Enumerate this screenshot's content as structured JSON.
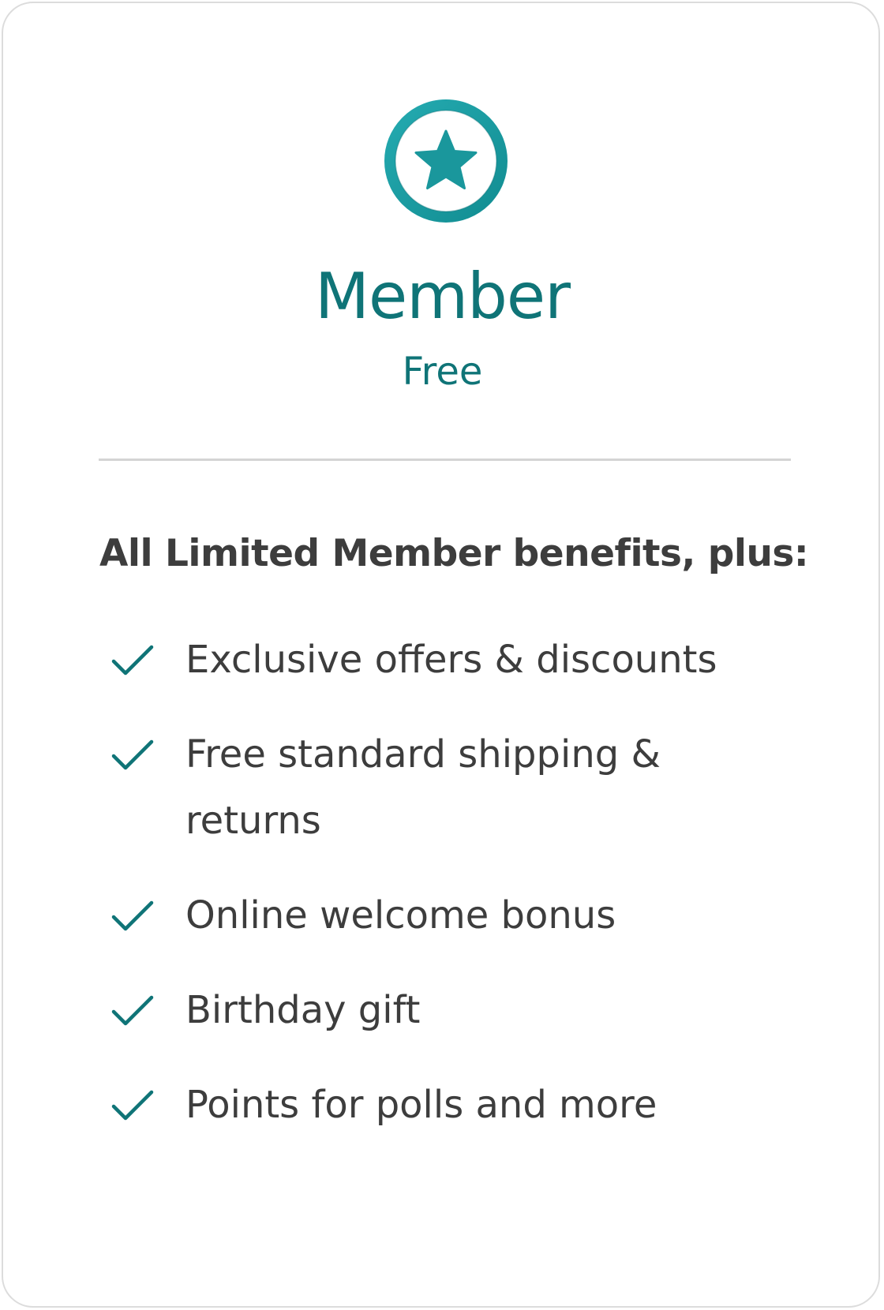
{
  "tier": {
    "name": "Member",
    "price": "Free",
    "badge_icon": "star-badge-icon",
    "accent_color": "#0f7477"
  },
  "benefits": {
    "heading": "All Limited Member benefits, plus:",
    "check_icon": "checkmark-icon",
    "items": [
      {
        "label": "Exclusive offers & discounts"
      },
      {
        "label": "Free standard shipping & returns"
      },
      {
        "label": "Online welcome bonus"
      },
      {
        "label": "Birthday gift"
      },
      {
        "label": "Points for polls and more"
      }
    ]
  }
}
